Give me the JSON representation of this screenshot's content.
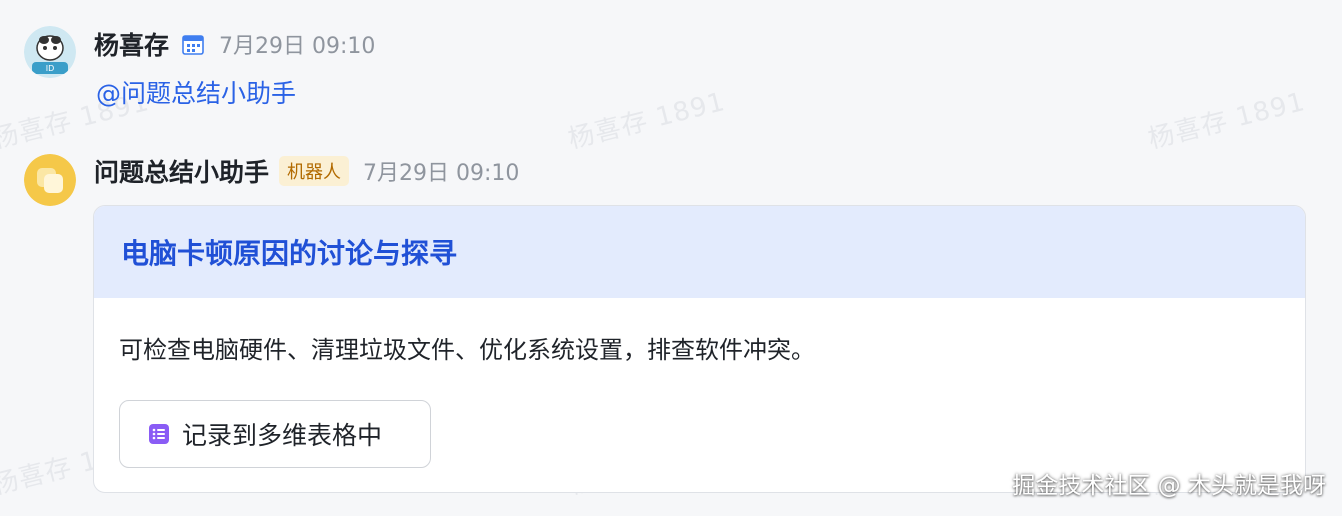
{
  "watermark": {
    "text": "杨喜存 1891"
  },
  "messages": [
    {
      "sender": "杨喜存",
      "time": "7月29日 09:10",
      "mention": "@问题总结小助手"
    },
    {
      "sender": "问题总结小助手",
      "badge": "机器人",
      "time": "7月29日 09:10",
      "card": {
        "title": "电脑卡顿原因的讨论与探寻",
        "body": "可检查电脑硬件、清理垃圾文件、优化系统设置，排查软件冲突。",
        "action_label": "记录到多维表格中"
      }
    }
  ],
  "source_mark": "掘金技术社区 @ 木头就是我呀",
  "colors": {
    "accent": "#2050d6",
    "mention": "#2a62e6",
    "card_header_bg": "#e3ebfd",
    "bot_tag_bg": "#fbf0d4",
    "bot_tag_text": "#b26a00"
  },
  "icons": {
    "calendar": "calendar-icon",
    "bitable": "bitable-icon",
    "avatar_user": "user-avatar",
    "avatar_bot": "bot-avatar"
  }
}
